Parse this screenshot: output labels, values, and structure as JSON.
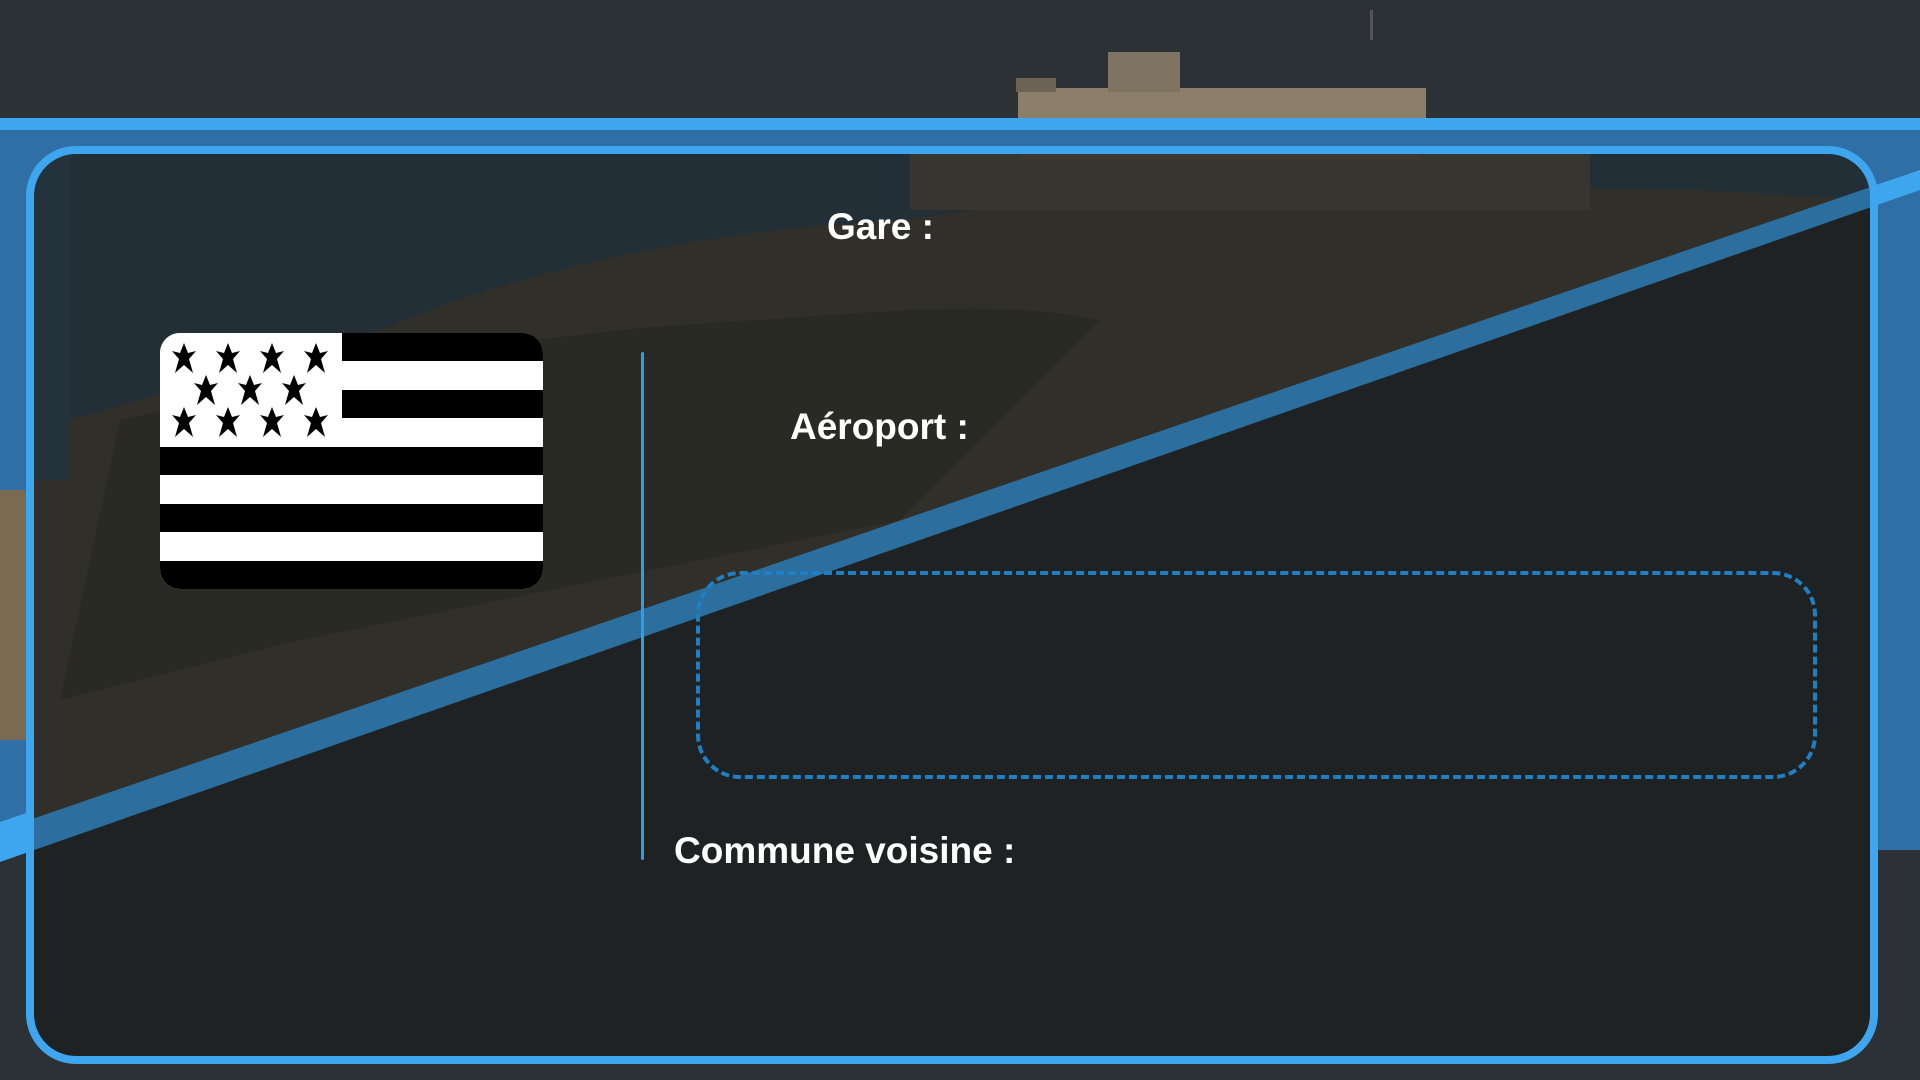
{
  "labels": {
    "gare": "Gare :",
    "aeroport": "Aéroport :",
    "commune_voisine": "Commune voisine :"
  },
  "icons": {
    "flag": "brittany-flag-icon"
  },
  "colors": {
    "accent": "#3ea6ee",
    "panel": "#1f2223",
    "top_band": "#2b3134",
    "dashed_border": "#1f7fc4"
  }
}
